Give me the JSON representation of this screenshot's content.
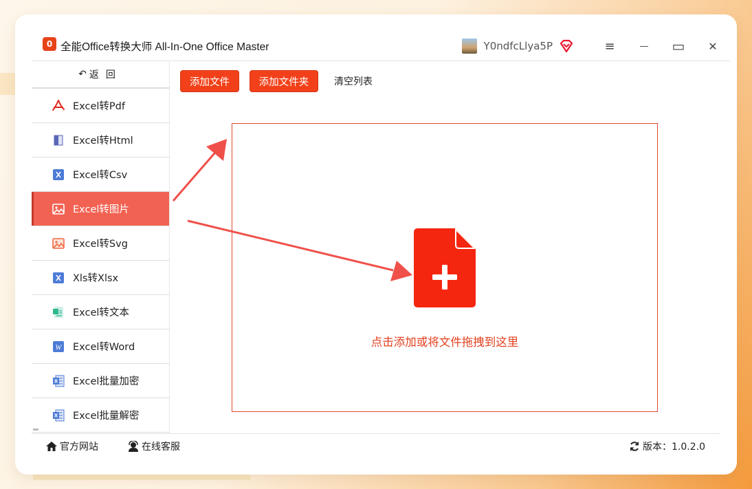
{
  "app": {
    "title": "全能Office转换大师 All-In-One Office Master",
    "logo_text": "0",
    "username": "Y0ndfcLlya5P"
  },
  "window_controls": {
    "menu": "≡",
    "minimize": "—",
    "maximize": "▭",
    "close": "✕"
  },
  "sidebar": {
    "back_label": "返回",
    "items": [
      {
        "label": "Excel转Pdf",
        "icon": "pdf-icon"
      },
      {
        "label": "Excel转Html",
        "icon": "html-icon"
      },
      {
        "label": "Excel转Csv",
        "icon": "csv-icon"
      },
      {
        "label": "Excel转图片",
        "icon": "image-icon",
        "active": true
      },
      {
        "label": "Excel转Svg",
        "icon": "svg-image-icon"
      },
      {
        "label": "Xls转Xlsx",
        "icon": "xlsx-icon"
      },
      {
        "label": "Excel转文本",
        "icon": "text-icon"
      },
      {
        "label": "Excel转Word",
        "icon": "word-icon"
      },
      {
        "label": "Excel批量加密",
        "icon": "excel-lock-icon"
      },
      {
        "label": "Excel批量解密",
        "icon": "excel-unlock-icon"
      }
    ]
  },
  "toolbar": {
    "add_file": "添加文件",
    "add_folder": "添加文件夹",
    "clear_list": "清空列表"
  },
  "dropzone": {
    "hint": "点击添加或将文件拖拽到这里"
  },
  "footer": {
    "website": "官方网站",
    "support": "在线客服",
    "version": "版本：1.0.2.0"
  },
  "colors": {
    "accent": "#f2411a",
    "active_nav": "#f26252",
    "arrow": "#f0504a"
  }
}
